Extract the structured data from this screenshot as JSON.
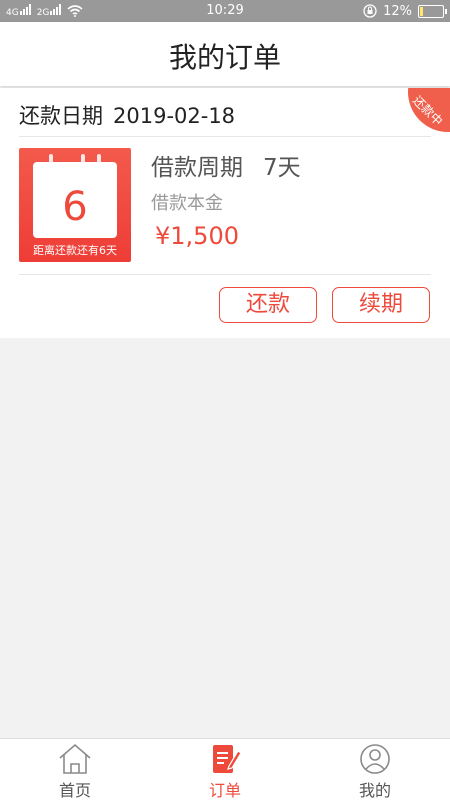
{
  "status_bar": {
    "signal_left": "4G",
    "signal_right": "2G",
    "time": "10:29",
    "battery": "12%",
    "battery_level": 0.12
  },
  "header": {
    "title": "我的订单"
  },
  "order": {
    "status_ribbon": "还款中",
    "due_label": "还款日期",
    "due_date": "2019-02-18",
    "calendar_number": "6",
    "calendar_caption": "距离还款还有6天",
    "period_label": "借款周期",
    "period_value": "7天",
    "principal_label": "借款本金",
    "amount": "¥1,500",
    "repay_button": "还款",
    "renew_button": "续期"
  },
  "tabbar": {
    "tabs": [
      {
        "label": "首页",
        "icon": "home-icon",
        "active": false
      },
      {
        "label": "订单",
        "icon": "order-icon",
        "active": true
      },
      {
        "label": "我的",
        "icon": "profile-icon",
        "active": false
      }
    ]
  },
  "colors": {
    "accent": "#ee4a3c",
    "statusbar": "#999999",
    "background": "#f2f2f2"
  }
}
